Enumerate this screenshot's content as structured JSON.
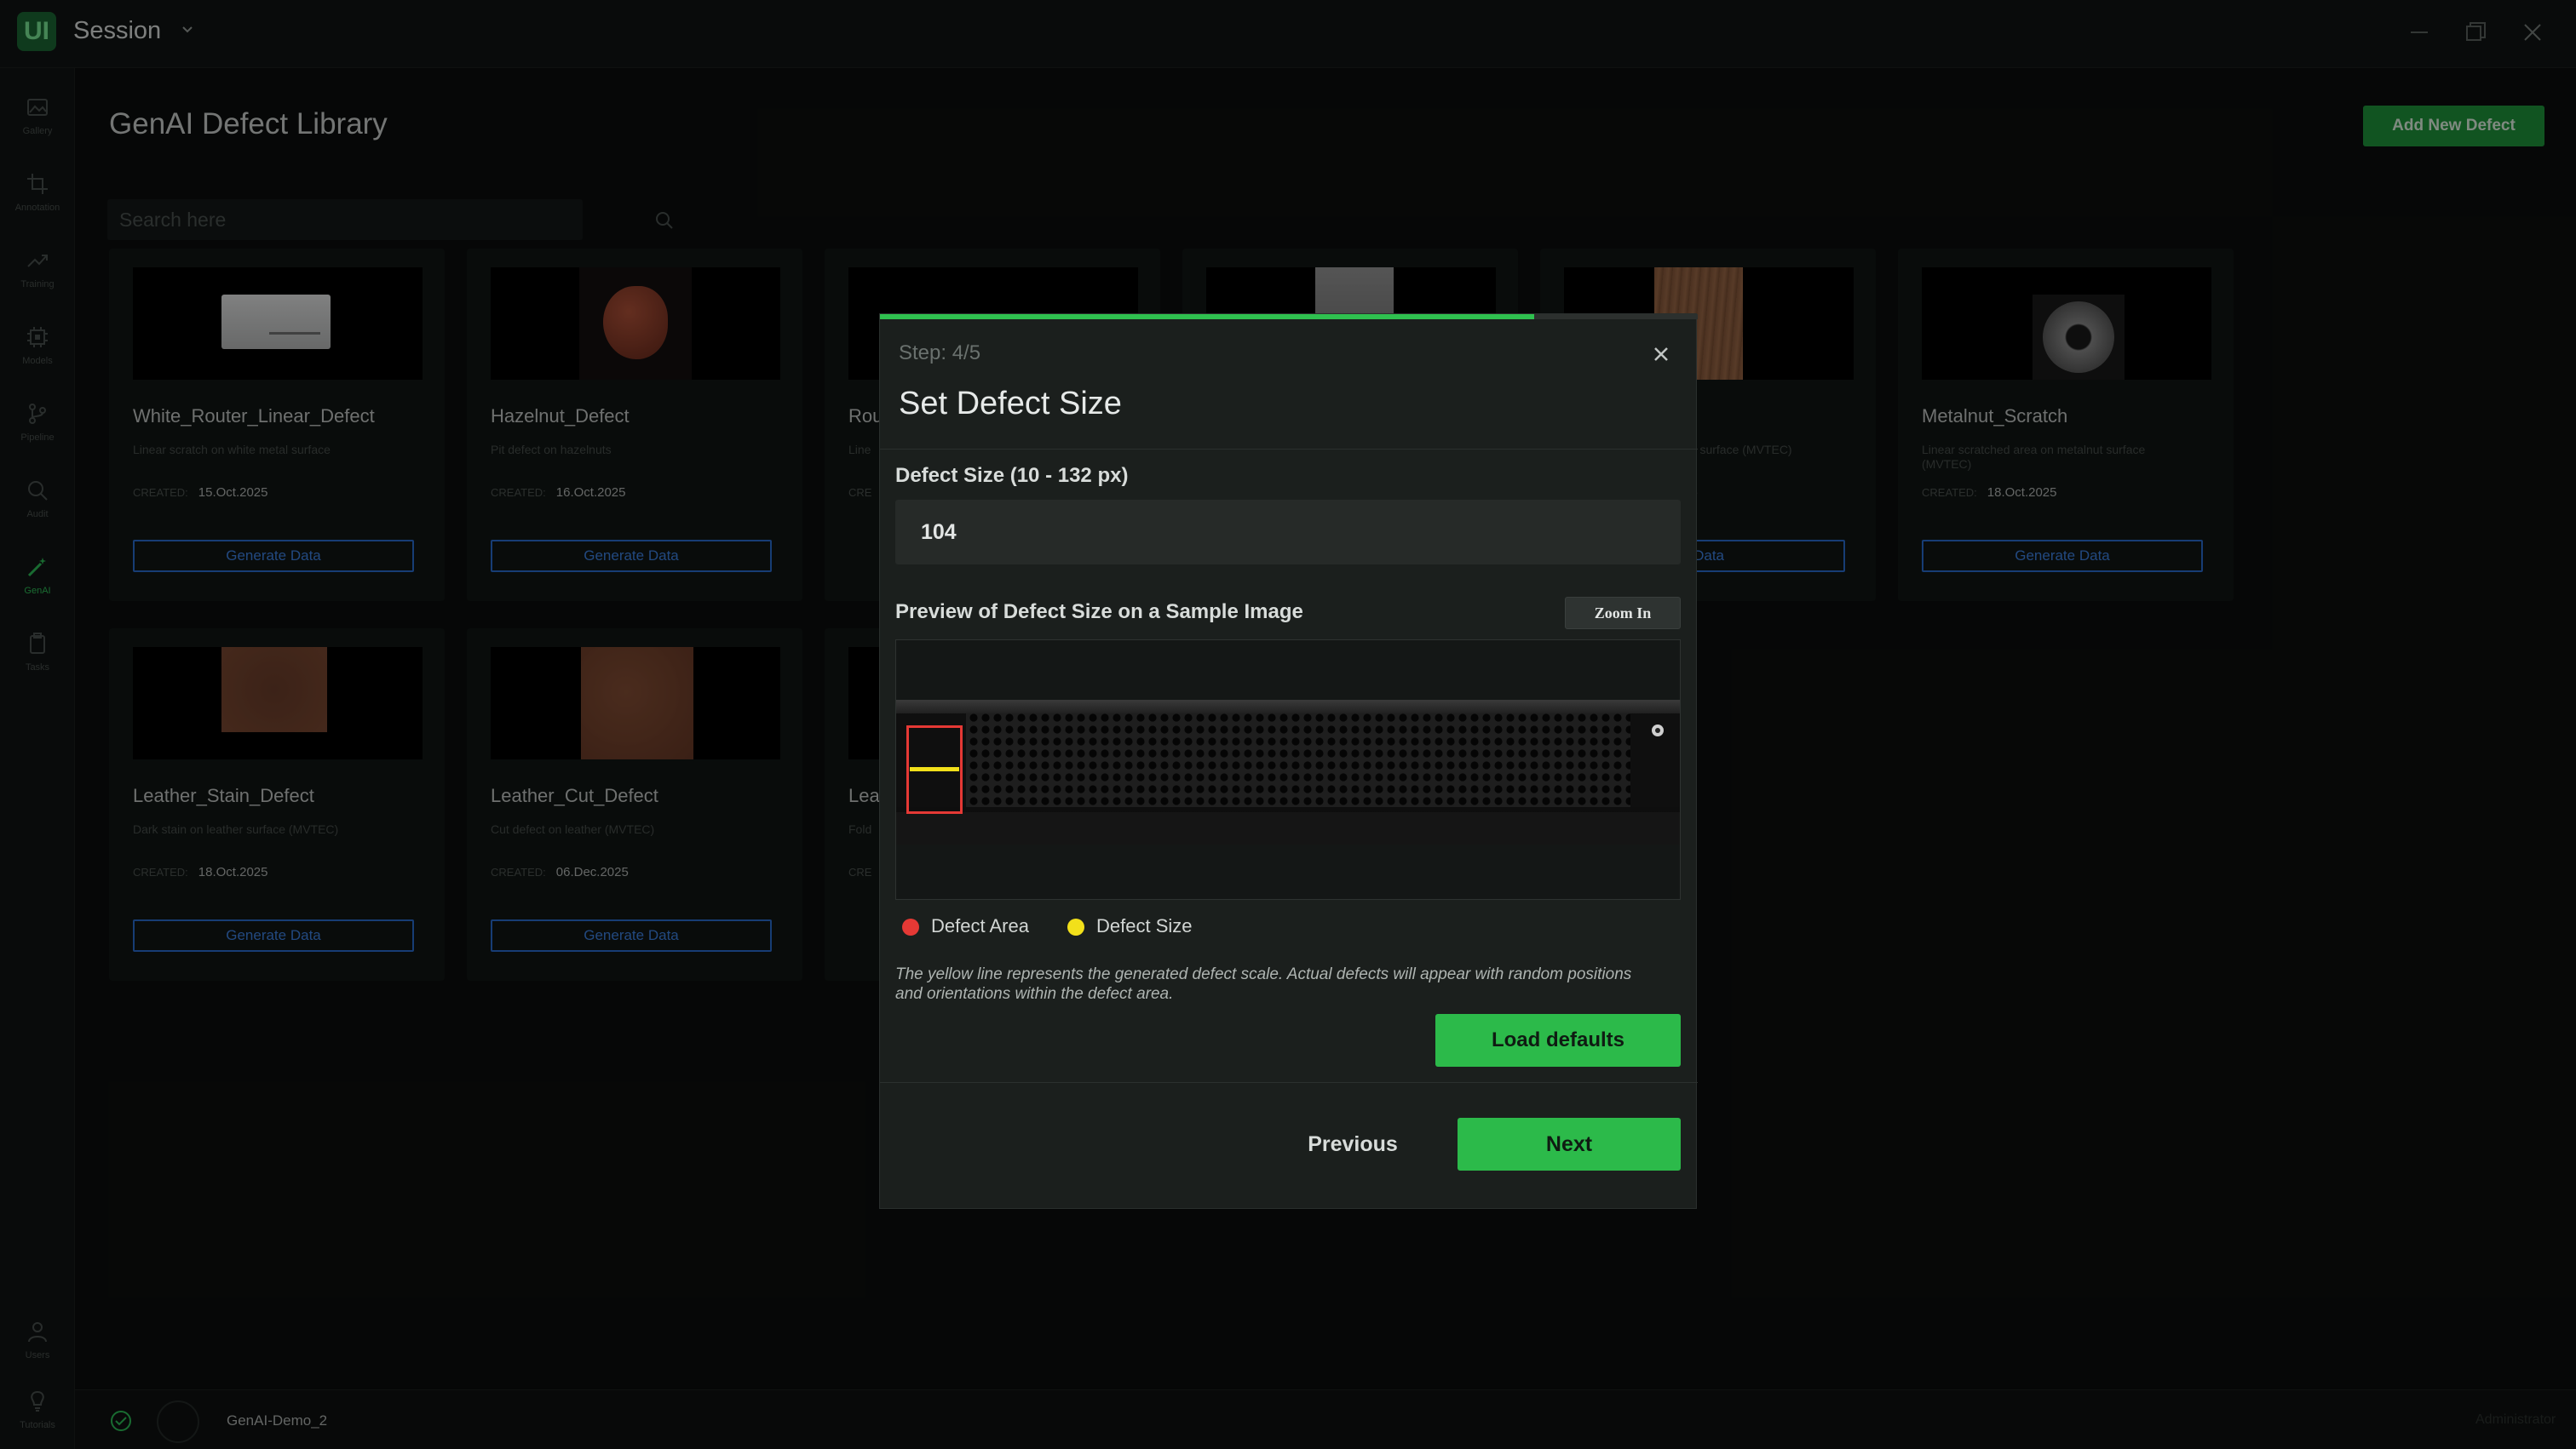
{
  "app": {
    "logo": "UI",
    "title": "Session",
    "window_controls": [
      "minimize-icon",
      "maximize-icon",
      "close-icon"
    ]
  },
  "sidebar": {
    "items": [
      {
        "label": "Gallery",
        "icon": "image-icon"
      },
      {
        "label": "Annotation",
        "icon": "crop-icon"
      },
      {
        "label": "Training",
        "icon": "trending-icon"
      },
      {
        "label": "Models",
        "icon": "chip-icon"
      },
      {
        "label": "Pipeline",
        "icon": "branch-icon"
      },
      {
        "label": "Audit",
        "icon": "search-icon"
      },
      {
        "label": "GenAI",
        "icon": "wand-icon",
        "active": true
      },
      {
        "label": "Tasks",
        "icon": "clipboard-icon"
      }
    ],
    "bottom_items": [
      {
        "label": "Users",
        "icon": "user-icon"
      },
      {
        "label": "Tutorials",
        "icon": "bulb-icon"
      }
    ]
  },
  "page": {
    "title": "GenAI Defect Library",
    "add_button": "Add New Defect",
    "search_placeholder": "Search here"
  },
  "cards": [
    {
      "title": "White_Router_Linear_Defect",
      "description": "Linear scratch on white metal surface",
      "created_label": "CREATED:",
      "created_date": "15.Oct.2025",
      "button": "Generate Data"
    },
    {
      "title": "Hazelnut_Defect",
      "description": "Pit defect on hazelnuts",
      "created_label": "CREATED:",
      "created_date": "16.Oct.2025",
      "button": "Generate Data"
    },
    {
      "title": "Rou",
      "description": "Line",
      "created_label": "CRE",
      "created_date": "",
      "button": ""
    },
    {
      "title": "",
      "description": "",
      "created_label": "",
      "created_date": "",
      "button": ""
    },
    {
      "title": "",
      "description": "od surface (MVTEC)",
      "created_label": "",
      "created_date": "25",
      "button": "ate Data"
    },
    {
      "title": "Metalnut_Scratch",
      "description": "Linear scratched area on metalnut surface (MVTEC)",
      "created_label": "CREATED:",
      "created_date": "18.Oct.2025",
      "button": "Generate Data"
    },
    {
      "title": "Leather_Stain_Defect",
      "description": "Dark stain on leather surface (MVTEC)",
      "created_label": "CREATED:",
      "created_date": "18.Oct.2025",
      "button": "Generate Data"
    },
    {
      "title": "Leather_Cut_Defect",
      "description": "Cut defect on leather (MVTEC)",
      "created_label": "CREATED:",
      "created_date": "06.Dec.2025",
      "button": "Generate Data"
    },
    {
      "title": "Lea",
      "description": "Fold",
      "created_label": "CRE",
      "created_date": "",
      "button": ""
    }
  ],
  "dialog": {
    "step": "Step: 4/5",
    "step_progress": 0.8,
    "title": "Set Defect Size",
    "size_label": "Defect Size (10 - 132 px)",
    "size_value": "104",
    "preview_label": "Preview of Defect Size on a Sample Image",
    "zoom_button": "Zoom In",
    "legend": {
      "area": {
        "label": "Defect Area",
        "color": "#e53935"
      },
      "size": {
        "label": "Defect Size",
        "color": "#f2e01a"
      }
    },
    "note": "The yellow line represents the generated defect scale. Actual defects will appear with random positions and orientations within the defect area.",
    "load_defaults": "Load defaults",
    "previous": "Previous",
    "next": "Next"
  },
  "status": {
    "project": "GenAI-Demo_2",
    "user": "Administrator"
  },
  "colors": {
    "accent": "#2cba4a",
    "link": "#2a6fd6"
  }
}
